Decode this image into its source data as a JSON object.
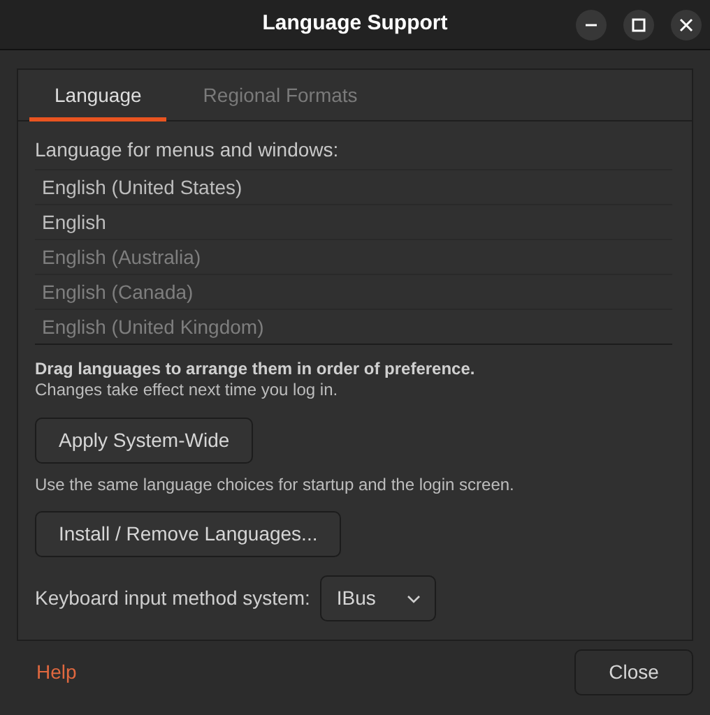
{
  "window": {
    "title": "Language Support"
  },
  "tabs": [
    {
      "label": "Language",
      "selected": true
    },
    {
      "label": "Regional Formats",
      "selected": false
    }
  ],
  "language_section": {
    "heading": "Language for menus and windows:",
    "languages": [
      {
        "label": "English (United States)",
        "dimmed": false
      },
      {
        "label": "English",
        "dimmed": false
      },
      {
        "label": "English (Australia)",
        "dimmed": true
      },
      {
        "label": "English (Canada)",
        "dimmed": true
      },
      {
        "label": "English (United Kingdom)",
        "dimmed": true
      }
    ],
    "hint": "Drag languages to arrange them in order of preference.",
    "note": "Changes take effect next time you log in."
  },
  "apply_button": "Apply System-Wide",
  "apply_note": "Use the same language choices for startup and the login screen.",
  "install_button": "Install / Remove Languages...",
  "input_method": {
    "label": "Keyboard input method system:",
    "value": "IBus"
  },
  "footer": {
    "help": "Help",
    "close": "Close"
  }
}
